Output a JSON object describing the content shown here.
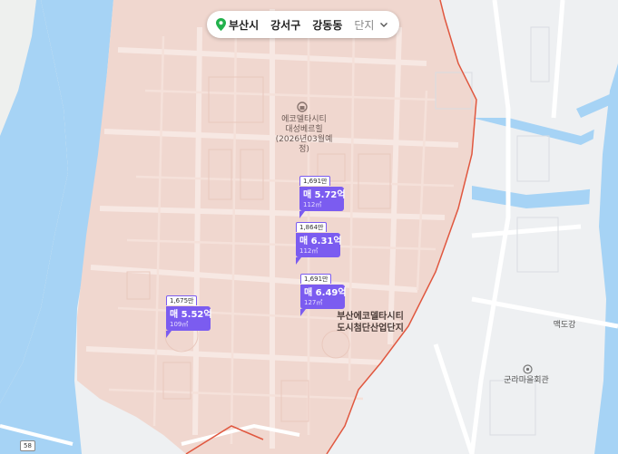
{
  "breadcrumb": {
    "city": "부산시",
    "district": "강서구",
    "dong": "강동동",
    "type": "단지"
  },
  "places": {
    "ecodelta_bestill_line1": "에코델타시티",
    "ecodelta_bestill_line2": "대성베르힐",
    "ecodelta_bestill_line3": "(2026년03월예정)",
    "industrial_line1": "부산에코델타시티",
    "industrial_line2": "도시첨단산업단지",
    "mokdogang": "맥도강",
    "gunramaeul": "군라마을회관"
  },
  "listings": [
    {
      "unit_price": "1,691만",
      "deal": "매 5.72억",
      "area": "112㎡"
    },
    {
      "unit_price": "1,864만",
      "deal": "매 6.31억",
      "area": "112㎡"
    },
    {
      "unit_price": "1,691만",
      "deal": "매 6.49억",
      "area": "127㎡"
    },
    {
      "unit_price": "1,675만",
      "deal": "매 5.52억",
      "area": "109㎡"
    }
  ],
  "road_number": "58",
  "colors": {
    "accent": "#7b5cf0",
    "water": "#a6d3f5",
    "district_fill": "#f0d7cf",
    "boundary": "#e0573f"
  }
}
